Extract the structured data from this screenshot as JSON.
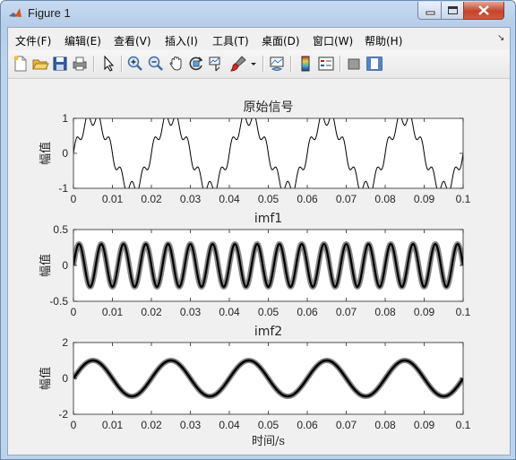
{
  "window": {
    "title": "Figure 1"
  },
  "menu": {
    "items": [
      "文件(F)",
      "编辑(E)",
      "查看(V)",
      "插入(I)",
      "工具(T)",
      "桌面(D)",
      "窗口(W)",
      "帮助(H)"
    ]
  },
  "toolbar": {
    "icons": [
      "new-figure-icon",
      "open-file-icon",
      "save-icon",
      "print-icon",
      "pointer-icon",
      "zoom-in-icon",
      "zoom-out-icon",
      "pan-hand-icon",
      "rotate-3d-icon",
      "data-cursor-icon",
      "brush-icon",
      "link-plot-icon",
      "colorbar-icon",
      "legend-icon",
      "hide-plot-tools-icon",
      "show-plot-tools-icon"
    ]
  },
  "chart_data": [
    {
      "type": "line",
      "title": "原始信号",
      "xlabel": "",
      "ylabel": "幅值",
      "xlim": [
        0,
        0.1
      ],
      "ylim": [
        -1,
        1
      ],
      "x_ticks": [
        "0",
        "0.01",
        "0.02",
        "0.03",
        "0.04",
        "0.05",
        "0.06",
        "0.07",
        "0.08",
        "0.09",
        "0.1"
      ],
      "y_ticks": [
        "-1",
        "0",
        "1"
      ],
      "series": [
        {
          "formula": "sin(2*pi*50*t) + 0.2*sin(2*pi*350*t)",
          "sample_rate_hz": 5000,
          "color": "#000000"
        }
      ]
    },
    {
      "type": "line",
      "title": "imf1",
      "xlabel": "",
      "ylabel": "幅值",
      "xlim": [
        0,
        0.1
      ],
      "ylim": [
        -0.5,
        0.5
      ],
      "x_ticks": [
        "0",
        "0.01",
        "0.02",
        "0.03",
        "0.04",
        "0.05",
        "0.06",
        "0.07",
        "0.08",
        "0.09",
        "0.1"
      ],
      "y_ticks": [
        "-0.5",
        "0",
        "0.5"
      ],
      "series": [
        {
          "formula": "0.3*sin(2*pi*175*t)",
          "sample_rate_hz": 5000,
          "color": "#888888"
        },
        {
          "formula": "0.3*sin(2*pi*175*t)",
          "sample_rate_hz": 5000,
          "color": "#000000"
        }
      ]
    },
    {
      "type": "line",
      "title": "imf2",
      "xlabel": "时间/s",
      "ylabel": "幅值",
      "xlim": [
        0,
        0.1
      ],
      "ylim": [
        -2,
        2
      ],
      "x_ticks": [
        "0",
        "0.01",
        "0.02",
        "0.03",
        "0.04",
        "0.05",
        "0.06",
        "0.07",
        "0.08",
        "0.09",
        "0.1"
      ],
      "y_ticks": [
        "-2",
        "0",
        "2"
      ],
      "series": [
        {
          "formula": "sin(2*pi*50*t)",
          "sample_rate_hz": 5000,
          "color": "#888888"
        },
        {
          "formula": "sin(2*pi*50*t)",
          "sample_rate_hz": 5000,
          "color": "#000000"
        }
      ]
    }
  ]
}
